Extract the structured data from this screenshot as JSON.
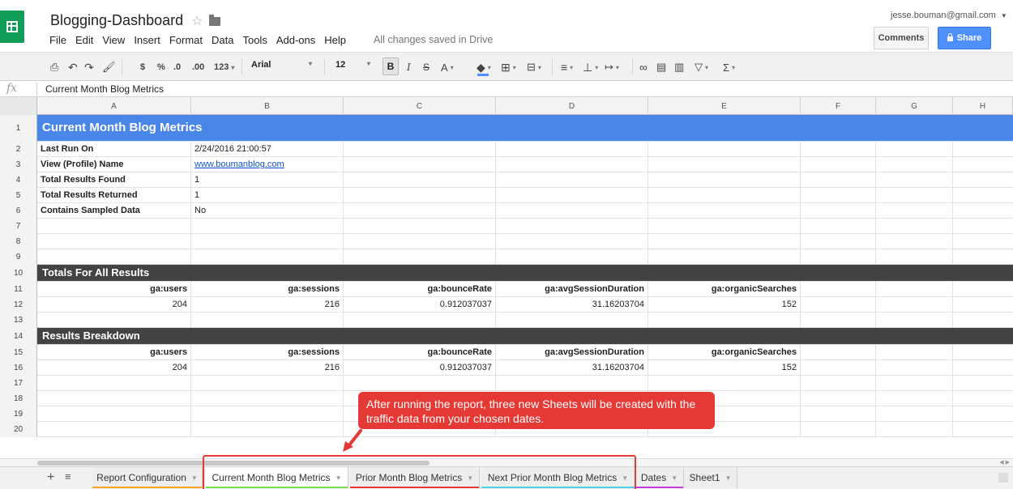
{
  "header": {
    "doc_title": "Blogging-Dashboard",
    "menu": [
      "File",
      "Edit",
      "View",
      "Insert",
      "Format",
      "Data",
      "Tools",
      "Add-ons",
      "Help"
    ],
    "saved_status": "All changes saved in Drive",
    "account": "jesse.bouman@gmail.com",
    "comments_label": "Comments",
    "share_label": "Share"
  },
  "toolbar": {
    "currency": "$",
    "percent": "%",
    "dec_less": ".0",
    "dec_more": ".00",
    "num_format": "123",
    "font": "Arial",
    "font_size": "12",
    "bold": "B",
    "italic": "I",
    "strike": "S",
    "text_color": "A",
    "sum": "Σ"
  },
  "formula_bar": {
    "fx": "fx",
    "content": "Current Month Blog Metrics"
  },
  "columns": [
    "A",
    "B",
    "C",
    "D",
    "E",
    "F",
    "G",
    "H"
  ],
  "rows": {
    "r1": {
      "num": "1",
      "title": "Current Month Blog Metrics"
    },
    "r2": {
      "num": "2",
      "a": "Last Run On",
      "b": "2/24/2016 21:00:57"
    },
    "r3": {
      "num": "3",
      "a": "View (Profile) Name",
      "b": "www.boumanblog.com"
    },
    "r4": {
      "num": "4",
      "a": "Total Results Found",
      "b": "1"
    },
    "r5": {
      "num": "5",
      "a": "Total Results Returned",
      "b": "1"
    },
    "r6": {
      "num": "6",
      "a": "Contains Sampled Data",
      "b": "No"
    },
    "r7": {
      "num": "7"
    },
    "r8": {
      "num": "8"
    },
    "r9": {
      "num": "9"
    },
    "r10": {
      "num": "10",
      "title": "Totals For All Results"
    },
    "r11": {
      "num": "11",
      "a": "ga:users",
      "b": "ga:sessions",
      "c": "ga:bounceRate",
      "d": "ga:avgSessionDuration",
      "e": "ga:organicSearches"
    },
    "r12": {
      "num": "12",
      "a": "204",
      "b": "216",
      "c": "0.912037037",
      "d": "31.16203704",
      "e": "152"
    },
    "r13": {
      "num": "13"
    },
    "r14": {
      "num": "14",
      "title": "Results Breakdown"
    },
    "r15": {
      "num": "15",
      "a": "ga:users",
      "b": "ga:sessions",
      "c": "ga:bounceRate",
      "d": "ga:avgSessionDuration",
      "e": "ga:organicSearches"
    },
    "r16": {
      "num": "16",
      "a": "204",
      "b": "216",
      "c": "0.912037037",
      "d": "31.16203704",
      "e": "152"
    },
    "r17": {
      "num": "17"
    },
    "r18": {
      "num": "18"
    },
    "r19": {
      "num": "19"
    },
    "r20": {
      "num": "20"
    }
  },
  "callout": {
    "text": "After running the report, three new Sheets will be created with the traffic data from your chosen dates."
  },
  "sheet_tabs": [
    {
      "label": "Report Configuration",
      "color": "#f6a623"
    },
    {
      "label": "Current Month Blog Metrics",
      "color": "#7ed957"
    },
    {
      "label": "Prior Month Blog Metrics",
      "color": "#e53935"
    },
    {
      "label": "Next Prior Month Blog Metrics",
      "color": "#4dd0e1"
    },
    {
      "label": "Dates",
      "color": "#c33fd8"
    },
    {
      "label": "Sheet1",
      "color": ""
    }
  ],
  "colors": {
    "title_row": "#4a86e8",
    "section_row": "#434343",
    "callout": "#e53935",
    "share": "#4d90fe",
    "brand": "#0f9d58"
  }
}
